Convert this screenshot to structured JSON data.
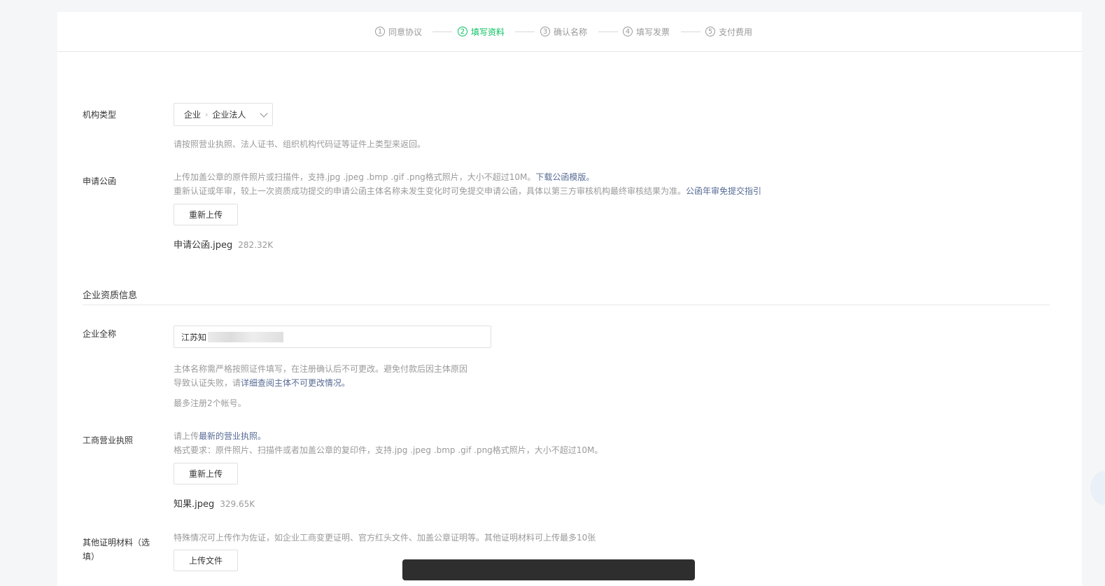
{
  "steps": [
    {
      "num": "1",
      "label": "同意协议"
    },
    {
      "num": "2",
      "label": "填写资料"
    },
    {
      "num": "3",
      "label": "确认名称"
    },
    {
      "num": "4",
      "label": "填写发票"
    },
    {
      "num": "5",
      "label": "支付费用"
    }
  ],
  "org_type": {
    "label": "机构类型",
    "value_level1": "企业",
    "value_level2": "企业法人",
    "hint": "请按照营业执照、法人证书、组织机构代码证等证件上类型来返回。"
  },
  "application_letter": {
    "label": "申请公函",
    "hint_line1": "上传加盖公章的原件照片或扫描件，支持.jpg .jpeg .bmp .gif .png格式照片，大小不超过10M。",
    "hint_link1": "下载公函模版。",
    "hint_line2": "重新认证或年审，较上一次资质成功提交的申请公函主体名称未发生变化时可免提交申请公函，具体以第三方审核机构最终审核结果为准。",
    "hint_link2": "公函年审免提交指引",
    "button": "重新上传",
    "file_name": "申请公函.jpeg",
    "file_size": "282.32K"
  },
  "section_title": "企业资质信息",
  "company_name": {
    "label": "企业全称",
    "value": "江苏知",
    "hint_line1": "主体名称需严格按照证件填写，在注册确认后不可更改。避免付款后因主体原因",
    "hint_line2_prefix": "导致认证失败，请",
    "hint_line2_link": "详细查阅主体不可更改情况。",
    "hint_line3": "最多注册2个帐号。"
  },
  "business_license": {
    "label": "工商营业执照",
    "hint_prefix": "请上传",
    "hint_link": "最新的营业执照。",
    "hint_line2": "格式要求：原件照片、扫描件或者加盖公章的复印件，支持.jpg .jpeg .bmp .gif .png格式照片，大小不超过10M。",
    "button": "重新上传",
    "file_name": "知果.jpeg",
    "file_size": "329.65K"
  },
  "other_docs": {
    "label": "其他证明材料（选填）",
    "hint": "特殊情况可上传作为佐证，如企业工商变更证明、官方红头文件、加盖公章证明等。其他证明材料可上传最多10张",
    "button": "上传文件"
  },
  "colors": {
    "accent_green": "#07c160",
    "link_blue": "#576b95",
    "hint_gray": "#9a9a9a"
  }
}
